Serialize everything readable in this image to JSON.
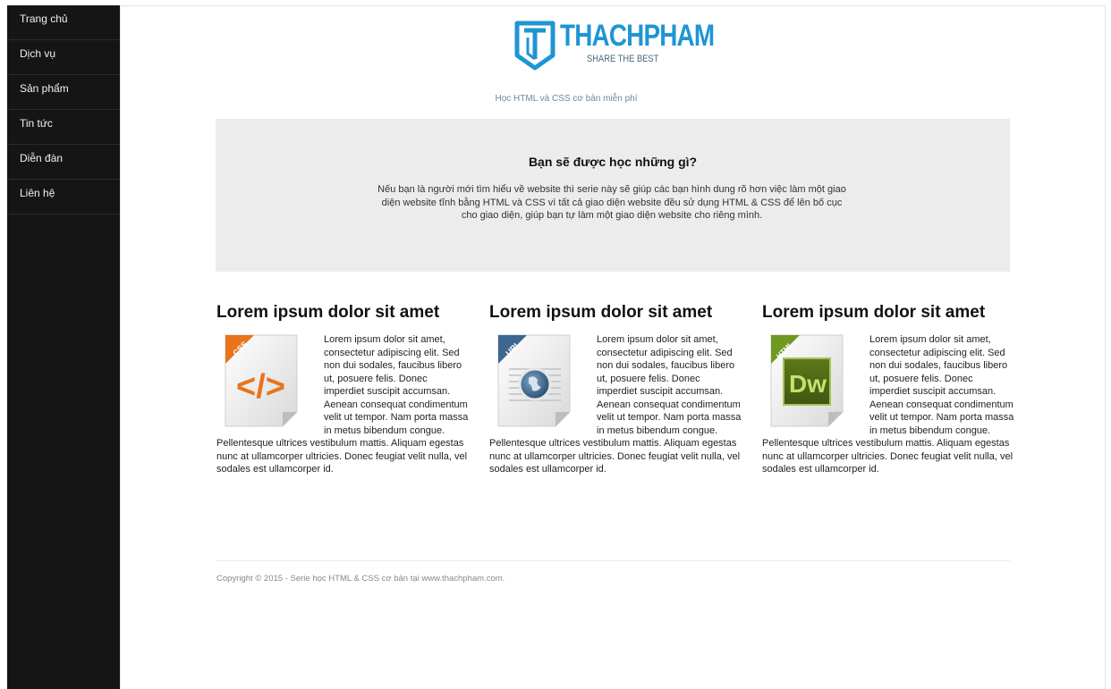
{
  "sidebar": {
    "items": [
      {
        "label": "Trang chủ"
      },
      {
        "label": "Dịch vụ"
      },
      {
        "label": "Sản phẩm"
      },
      {
        "label": "Tin tức"
      },
      {
        "label": "Diễn đàn"
      },
      {
        "label": "Liên hệ"
      }
    ]
  },
  "header": {
    "logo_text": "THACHPHAM",
    "logo_subtitle": "SHARE THE BEST",
    "tagline": "Học HTML và CSS cơ bản miễn phí"
  },
  "hero": {
    "title": "Bạn sẽ được học những gì?",
    "text": "Nếu bạn là người mới tìm hiểu về website thì serie này sẽ giúp các bạn hình dung rõ hơn việc làm một giao diện website tĩnh bằng HTML và CSS vì tất cả giao diện website đều sử dụng HTML & CSS để lên bố cục cho giao diện, giúp bạn tự làm một giao diện website cho riêng mình."
  },
  "columns": [
    {
      "title": "Lorem ipsum dolor sit amet",
      "icon_label": "CSS",
      "icon_glyph": "</>",
      "body": "Lorem ipsum dolor sit amet, consectetur adipiscing elit. Sed non dui sodales, faucibus libero ut, posuere felis. Donec imperdiet suscipit accumsan. Aenean consequat condimentum velit ut tempor. Nam porta massa in metus bibendum congue. Pellentesque ultrices vestibulum mattis. Aliquam egestas nunc at ullamcorper ultricies. Donec feugiat velit nulla, vel sodales est ullamcorper id."
    },
    {
      "title": "Lorem ipsum dolor sit amet",
      "icon_label": "URL",
      "icon_glyph": "",
      "body": "Lorem ipsum dolor sit amet, consectetur adipiscing elit. Sed non dui sodales, faucibus libero ut, posuere felis. Donec imperdiet suscipit accumsan. Aenean consequat condimentum velit ut tempor. Nam porta massa in metus bibendum congue. Pellentesque ultrices vestibulum mattis. Aliquam egestas nunc at ullamcorper ultricies. Donec feugiat velit nulla, vel sodales est ullamcorper id."
    },
    {
      "title": "Lorem ipsum dolor sit amet",
      "icon_label": "HTML",
      "icon_glyph": "Dw",
      "body": "Lorem ipsum dolor sit amet, consectetur adipiscing elit. Sed non dui sodales, faucibus libero ut, posuere felis. Donec imperdiet suscipit accumsan. Aenean consequat condimentum velit ut tempor. Nam porta massa in metus bibendum congue. Pellentesque ultrices vestibulum mattis. Aliquam egestas nunc at ullamcorper ultricies. Donec feugiat velit nulla, vel sodales est ullamcorper id."
    }
  ],
  "footer": {
    "copyright": "Copyright © 2015 - Serie học HTML & CSS cơ bản tại www.thachpham.com."
  },
  "colors": {
    "sidebar_bg": "#151515",
    "brand_blue": "#1f95d3",
    "hero_bg": "#ececec",
    "css_orange": "#e8741c",
    "url_blue": "#3d6690",
    "html_green": "#6f9a1f"
  },
  "icons": [
    "logo-mark",
    "css-file-icon",
    "url-file-icon",
    "dreamweaver-file-icon"
  ]
}
